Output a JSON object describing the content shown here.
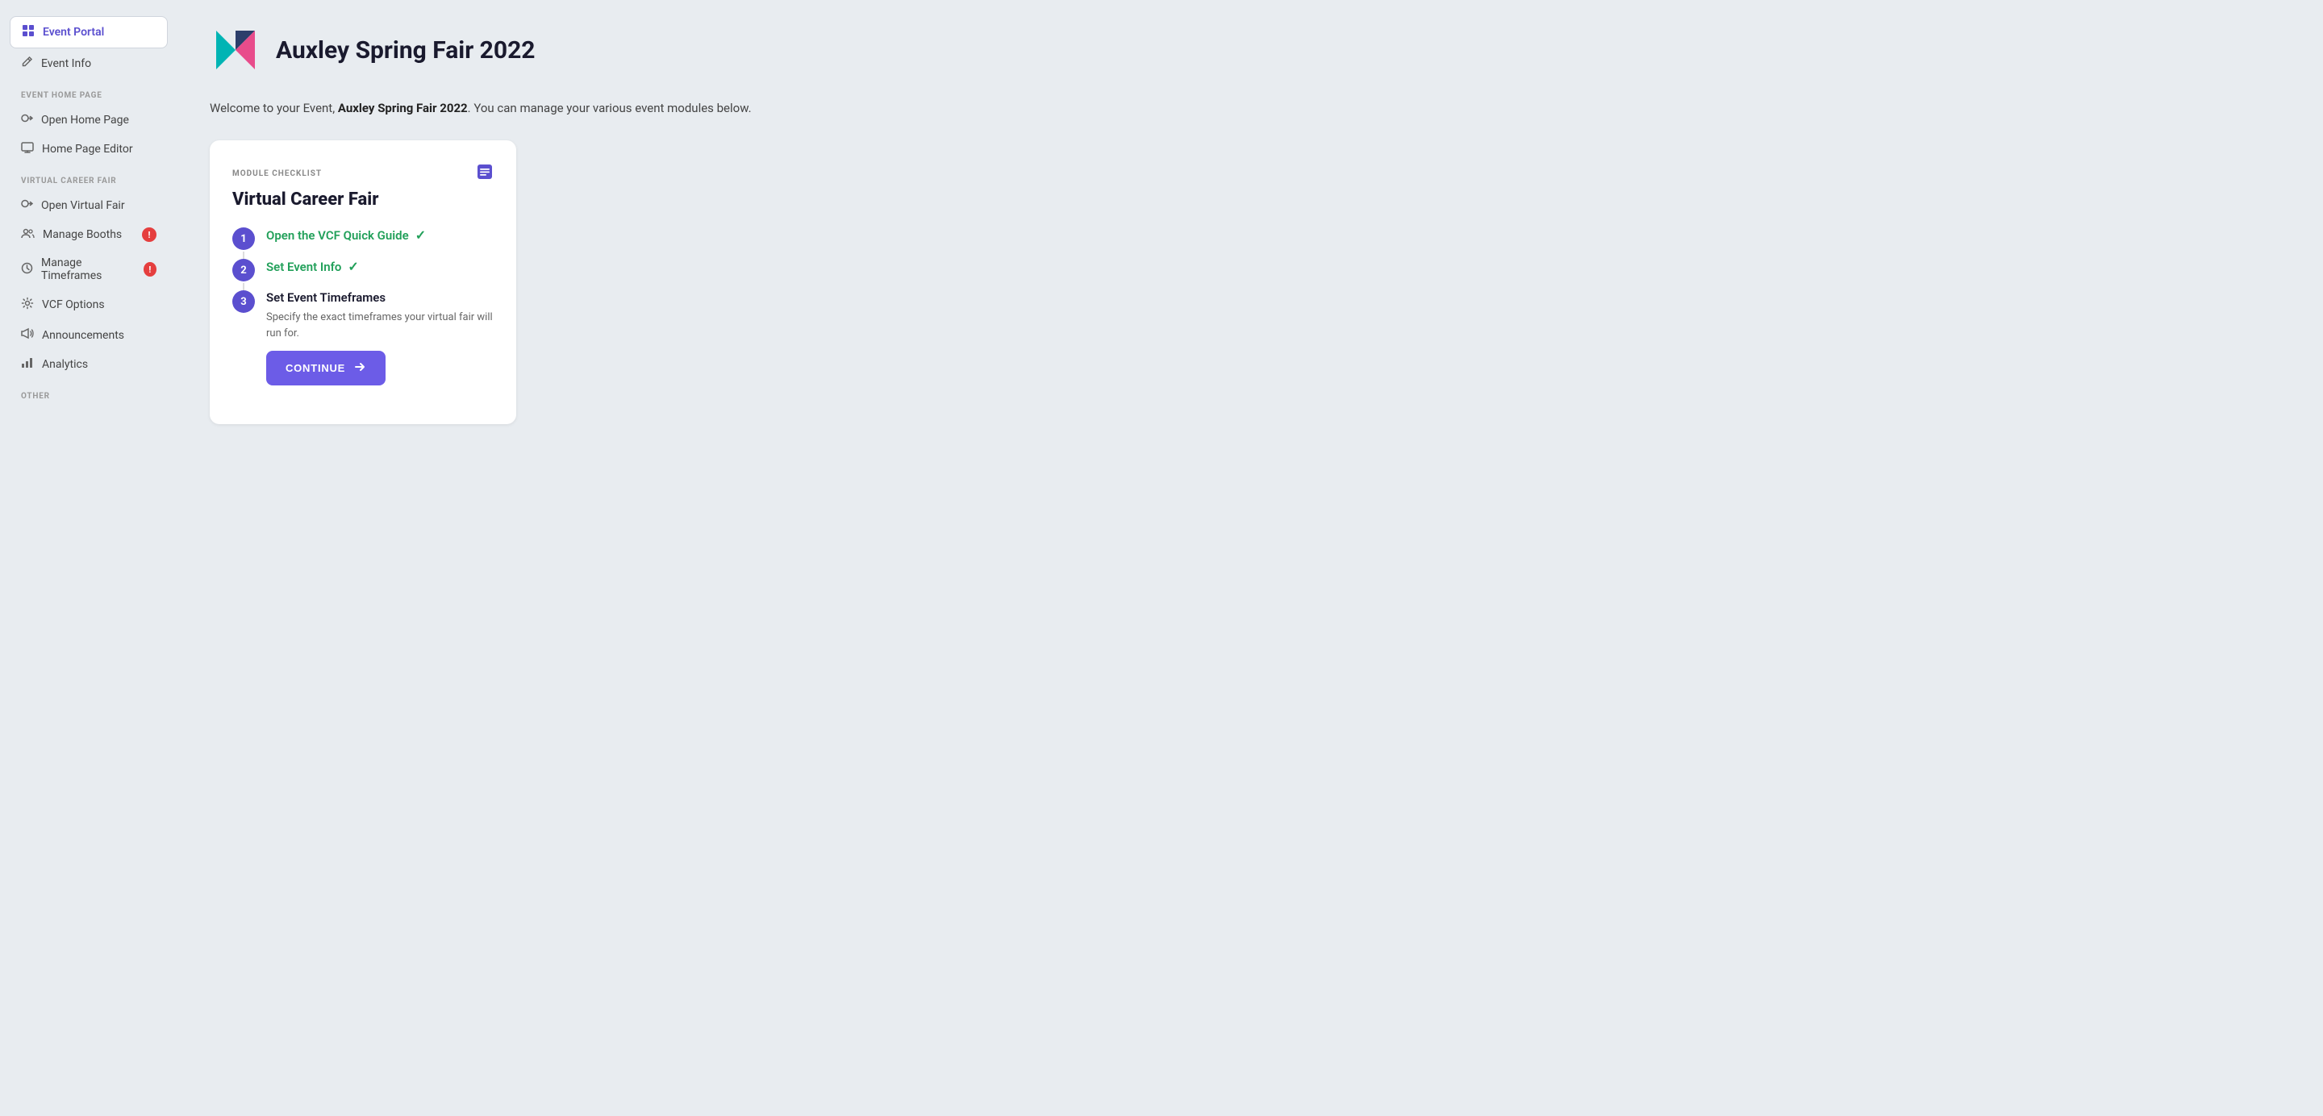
{
  "app": {
    "title": "Auxley Spring Fair 2022",
    "logo_alt": "Auxley Logo"
  },
  "welcome": {
    "prefix": "Welcome to your Event, ",
    "event_name": "Auxley Spring Fair 2022",
    "suffix": ". You can manage your various event modules below."
  },
  "sidebar": {
    "active_item": "event-portal",
    "items": [
      {
        "id": "event-portal",
        "label": "Event Portal",
        "icon": "⊞",
        "active": true,
        "badge": null
      },
      {
        "id": "event-info",
        "label": "Event Info",
        "icon": "✎",
        "active": false,
        "badge": null
      }
    ],
    "sections": [
      {
        "label": "EVENT HOME PAGE",
        "items": [
          {
            "id": "open-home-page",
            "label": "Open Home Page",
            "icon": "→",
            "badge": null
          },
          {
            "id": "home-page-editor",
            "label": "Home Page Editor",
            "icon": "▬",
            "badge": null
          }
        ]
      },
      {
        "label": "VIRTUAL CAREER FAIR",
        "items": [
          {
            "id": "open-virtual-fair",
            "label": "Open Virtual Fair",
            "icon": "→",
            "badge": null
          },
          {
            "id": "manage-booths",
            "label": "Manage Booths",
            "icon": "👥",
            "badge": "!"
          },
          {
            "id": "manage-timeframes",
            "label": "Manage Timeframes",
            "icon": "🕐",
            "badge": "!"
          },
          {
            "id": "vcf-options",
            "label": "VCF Options",
            "icon": "⚙",
            "badge": null
          },
          {
            "id": "announcements",
            "label": "Announcements",
            "icon": "📢",
            "badge": null
          },
          {
            "id": "analytics",
            "label": "Analytics",
            "icon": "📊",
            "badge": null
          }
        ]
      },
      {
        "label": "OTHER",
        "items": []
      }
    ]
  },
  "checklist": {
    "module_label": "MODULE CHECKLIST",
    "title": "Virtual Career Fair",
    "steps": [
      {
        "number": "1",
        "label": "Open the VCF Quick Guide",
        "completed": true,
        "description": null,
        "has_button": false
      },
      {
        "number": "2",
        "label": "Set Event Info",
        "completed": true,
        "description": null,
        "has_button": false
      },
      {
        "number": "3",
        "label": "Set Event Timeframes",
        "completed": false,
        "description": "Specify the exact timeframes your virtual fair will run for.",
        "has_button": true,
        "button_label": "CONTINUE"
      }
    ]
  },
  "icons": {
    "grid": "⊞",
    "edit": "✏",
    "arrow_right": "→",
    "monitor": "▬",
    "users": "👥",
    "clock": "⏱",
    "gear": "⚙",
    "megaphone": "📣",
    "chart": "📈",
    "list": "≡",
    "checkmark": "✓",
    "arrow_btn": "→"
  }
}
